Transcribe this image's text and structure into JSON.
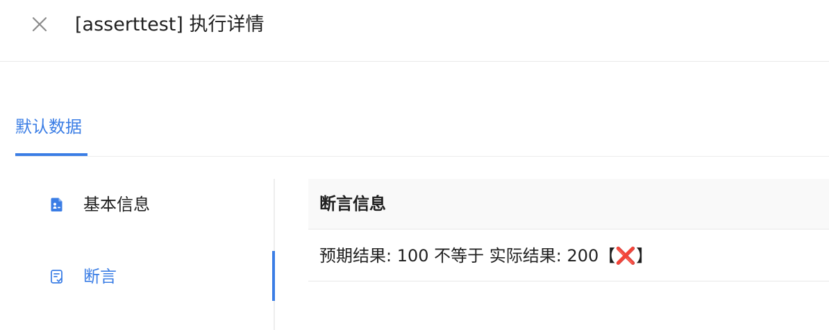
{
  "header": {
    "title": "[asserttest] 执行详情",
    "close_icon": "close-icon"
  },
  "tabs": [
    {
      "label": "默认数据",
      "active": true
    }
  ],
  "side_nav": {
    "items": [
      {
        "label": "基本信息",
        "icon": "document-icon",
        "active": false
      },
      {
        "label": "断言",
        "icon": "checklist-icon",
        "active": true
      }
    ]
  },
  "panel": {
    "header": "断言信息",
    "rows": [
      {
        "text": "预期结果: 100 不等于 实际结果: 200【❌】"
      }
    ]
  },
  "colors": {
    "accent": "#3a7de5",
    "text": "#1f1f1f",
    "border": "#e8e8e8",
    "header_bg": "#f9f9f9"
  }
}
